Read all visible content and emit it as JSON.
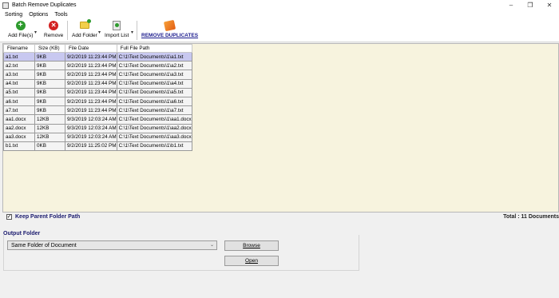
{
  "window": {
    "title": "Batch Remove Duplicates",
    "controls": [
      "–",
      "❐",
      "✕"
    ]
  },
  "menu": [
    {
      "label": "Sorting"
    },
    {
      "label": "Options"
    },
    {
      "label": "Tools"
    }
  ],
  "toolbar": {
    "add_files": "Add File(s)",
    "remove": "Remove",
    "add_folder": "Add Folder",
    "import_list": "Import List",
    "remove_duplicates": "REMOVE DUPLICATES",
    "dropdown_glyph": "▾"
  },
  "table": {
    "columns": [
      "Filename",
      "Size (KB)",
      "File Date",
      "Full File Path"
    ],
    "rows": [
      [
        "a1.txt",
        "9KB",
        "9/2/2019 11:23:44 PM",
        "C:\\1\\Text Documents\\1\\a1.txt"
      ],
      [
        "a2.txt",
        "9KB",
        "9/2/2019 11:23:44 PM",
        "C:\\1\\Text Documents\\1\\a2.txt"
      ],
      [
        "a3.txt",
        "9KB",
        "9/2/2019 11:23:44 PM",
        "C:\\1\\Text Documents\\1\\a3.txt"
      ],
      [
        "a4.txt",
        "9KB",
        "9/2/2019 11:23:44 PM",
        "C:\\1\\Text Documents\\1\\a4.txt"
      ],
      [
        "a5.txt",
        "9KB",
        "9/2/2019 11:23:44 PM",
        "C:\\1\\Text Documents\\1\\a5.txt"
      ],
      [
        "a6.txt",
        "9KB",
        "9/2/2019 11:23:44 PM",
        "C:\\1\\Text Documents\\1\\a6.txt"
      ],
      [
        "a7.txt",
        "9KB",
        "9/2/2019 11:23:44 PM",
        "C:\\1\\Text Documents\\1\\a7.txt"
      ],
      [
        "aa1.docx",
        "12KB",
        "9/3/2019 12:03:24 AM",
        "C:\\1\\Text Documents\\1\\aa1.docx"
      ],
      [
        "aa2.docx",
        "12KB",
        "9/3/2019 12:03:24 AM",
        "C:\\1\\Text Documents\\1\\aa2.docx"
      ],
      [
        "aa3.docx",
        "12KB",
        "9/3/2019 12:03:24 AM",
        "C:\\1\\Text Documents\\1\\aa3.docx"
      ],
      [
        "b1.txt",
        "0KB",
        "9/2/2019 11:25:02 PM",
        "C:\\1\\Text Documents\\1\\b1.txt"
      ]
    ],
    "selected_row": 0
  },
  "options": {
    "keep_parent_label": "Keep Parent Folder Path",
    "keep_parent_checked": "✓",
    "total": "Total : 11 Documents"
  },
  "output": {
    "legend": "Output Folder",
    "select_value": "Same Folder of Document",
    "select_caret": "⌄",
    "browse": "Browse",
    "open": "Open"
  },
  "colors": {
    "list_background": "#f7f3de",
    "selected_row": "#c8c8f0",
    "accent_text": "#1a1a6e"
  }
}
